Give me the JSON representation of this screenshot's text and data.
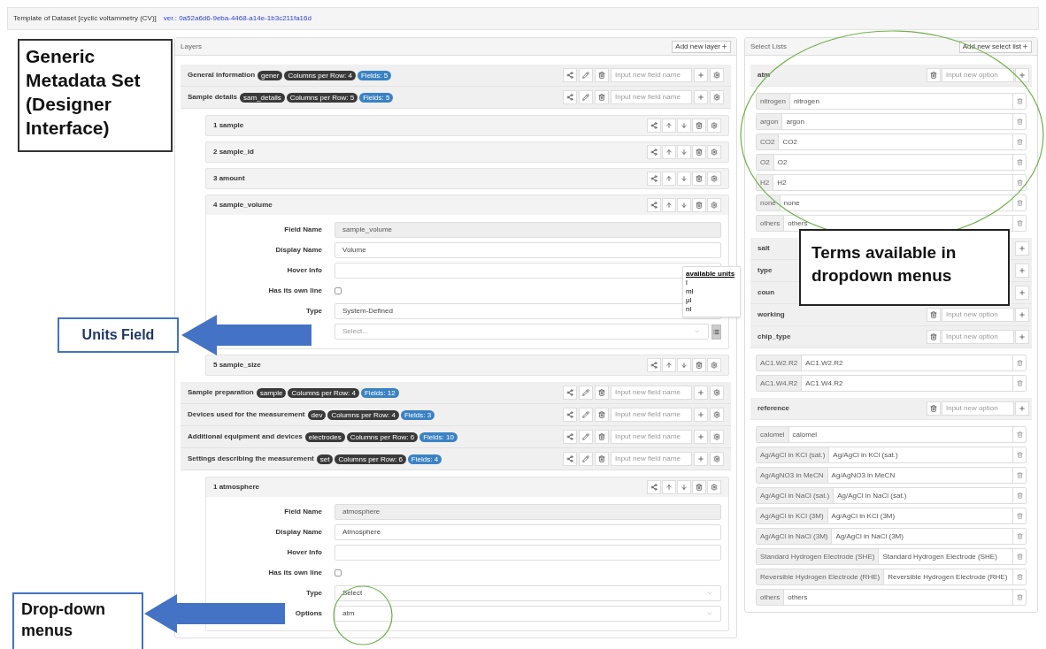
{
  "header": {
    "title": "Template of Dataset [cyclic voltammetry (CV)]",
    "version": "ver.: 0a52a6d6-9eba-4468-a14e-1b3c211fa16d"
  },
  "layers_panel": {
    "title": "Layers",
    "add_button": "Add new layer",
    "layers": [
      {
        "name": "General information",
        "key": "gener",
        "columns": "Columns per Row: 4",
        "fields": "Fields: 5",
        "placeholder": "Input new field name"
      },
      {
        "name": "Sample details",
        "key": "sam_details",
        "columns": "Columns per Row: 5",
        "fields": "Fields: 5",
        "placeholder": "Input new field name",
        "children": [
          {
            "label": "1 sample"
          },
          {
            "label": "2 sample_id"
          },
          {
            "label": "3 amount"
          },
          {
            "label": "4 sample_volume",
            "form": [
              {
                "kind": "readonly",
                "label": "Field Name",
                "value": "sample_volume"
              },
              {
                "kind": "text",
                "label": "Display Name",
                "value": "Volume"
              },
              {
                "kind": "text",
                "label": "Hover Info"
              },
              {
                "kind": "checkbox",
                "label": "Has its own line",
                "checked": false
              },
              {
                "kind": "text",
                "label": "Type",
                "value": "System-Defined"
              },
              {
                "kind": "units",
                "placeholder": "Select...",
                "popover": {
                  "title": "available units",
                  "units": [
                    "l",
                    "ml",
                    "μl",
                    "nl"
                  ]
                }
              }
            ]
          },
          {
            "label": "5 sample_size"
          }
        ]
      },
      {
        "name": "Sample preparation",
        "key": "sample",
        "columns": "Columns per Row: 4",
        "fields": "Fields: 12",
        "placeholder": "Input new field name"
      },
      {
        "name": "Devices used for the measurement",
        "key": "dev",
        "columns": "Columns per Row: 4",
        "fields": "Fields: 3",
        "placeholder": "Input new field name"
      },
      {
        "name": "Additional equipment and devices",
        "key": "electrodes",
        "columns": "Columns per Row: 6",
        "fields": "Fields: 10",
        "placeholder": "Input new field name"
      },
      {
        "name": "Settings describing the measurement",
        "key": "set",
        "columns": "Columns per Row: 6",
        "fields": "Fields: 4",
        "placeholder": "Input new field name",
        "children": [
          {
            "label": "1 atmosphere",
            "form": [
              {
                "kind": "readonly",
                "label": "Field Name",
                "value": "atmosphere"
              },
              {
                "kind": "text",
                "label": "Display Name",
                "value": "Atmosphere"
              },
              {
                "kind": "text",
                "label": "Hover Info"
              },
              {
                "kind": "checkbox",
                "label": "Has its own line",
                "checked": false
              },
              {
                "kind": "select",
                "label": "Type",
                "value": "Select"
              },
              {
                "kind": "select",
                "label": "Options",
                "value": "atm"
              }
            ]
          }
        ]
      }
    ]
  },
  "select_lists_panel": {
    "title": "Select Lists",
    "add_button": "Add new select list",
    "lists": [
      {
        "name": "atm",
        "placeholder": "Input new option",
        "options": [
          {
            "key": "nitrogen",
            "value": "nitrogen"
          },
          {
            "key": "argon",
            "value": "argon"
          },
          {
            "key": "CO2",
            "value": "CO2"
          },
          {
            "key": "O2",
            "value": "O2"
          },
          {
            "key": "H2",
            "value": "H2"
          },
          {
            "key": "none",
            "value": "none"
          },
          {
            "key": "others",
            "value": "others"
          }
        ]
      },
      {
        "name": "salt"
      },
      {
        "name": "type"
      },
      {
        "name": "coun"
      },
      {
        "name": "working",
        "placeholder": "Input new option"
      },
      {
        "name": "chip_type",
        "placeholder": "Input new option",
        "options": [
          {
            "key": "AC1.W2.R2",
            "value": "AC1.W2.R2"
          },
          {
            "key": "AC1.W4.R2",
            "value": "AC1.W4.R2"
          }
        ]
      },
      {
        "name": "reference",
        "placeholder": "Input new option",
        "options": [
          {
            "key": "calomel",
            "value": "calomel"
          },
          {
            "key": "Ag/AgCl in KCl (sat.)",
            "value": "Ag/AgCl in KCl (sat.)"
          },
          {
            "key": "Ag/AgNO3 in MeCN",
            "value": "Ag/AgNO3 in MeCN"
          },
          {
            "key": "Ag/AgCl in NaCl (sat.)",
            "value": "Ag/AgCl in NaCl (sat.)"
          },
          {
            "key": "Ag/AgCl in KCl (3M)",
            "value": "Ag/AgCl in KCl (3M)"
          },
          {
            "key": "Ag/AgCl in NaCl (3M)",
            "value": "Ag/AgCl in NaCl (3M)"
          },
          {
            "key": "Standard Hydrogen Electrode (SHE)",
            "value": "Standard Hydrogen Electrode (SHE)"
          },
          {
            "key": "Reversible Hydrogen Electrode (RHE)",
            "value": "Reversible Hydrogen Electrode (RHE)"
          },
          {
            "key": "others",
            "value": "others"
          }
        ]
      }
    ]
  },
  "callouts": {
    "designer": "Generic Metadata Set (Designer Interface)",
    "units": "Units Field",
    "terms": "Terms available in dropdown menus",
    "dropdowns": "Drop-down menus"
  }
}
